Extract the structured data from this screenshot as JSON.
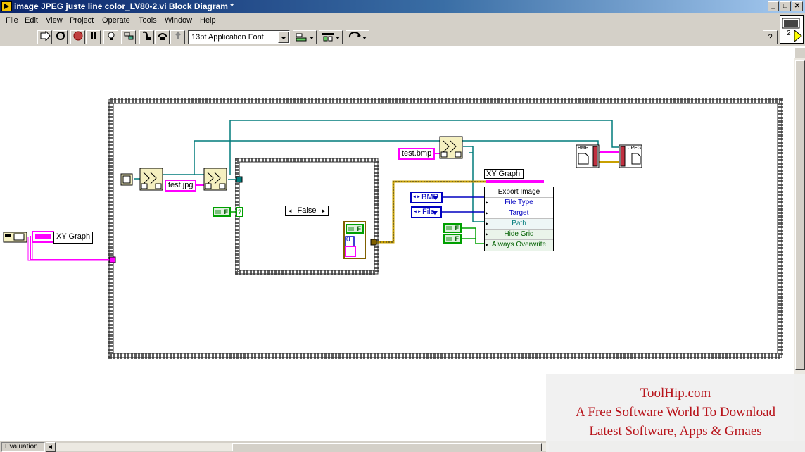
{
  "window": {
    "title": "image JPEG juste line color_LV80-2.vi Block Diagram *",
    "controls": {
      "minimize": "_",
      "maximize": "□",
      "close": "✕"
    },
    "doc_controls": {
      "minimize": "_",
      "maximize": "□",
      "close": "✕"
    }
  },
  "menu": [
    "File",
    "Edit",
    "View",
    "Project",
    "Operate",
    "Tools",
    "Window",
    "Help"
  ],
  "toolbar": {
    "font": "13pt Application Font",
    "buttons": [
      "run-arrow",
      "run-continuous",
      "abort",
      "pause",
      "highlight-execution",
      "retain-wire-values",
      "step-into",
      "step-over",
      "step-out"
    ],
    "help": "?"
  },
  "vi_icon": {
    "label": "2"
  },
  "diagram": {
    "xy_graph_terminal": "XY Graph",
    "string_jpg": "test.jpg",
    "string_bmp": "test.bmp",
    "case_selector": "False",
    "numeric_const": "0",
    "bool_true_label": "F",
    "property_node": {
      "title": "XY Graph",
      "rows": [
        "Export Image",
        "File Type",
        "Target",
        "Path",
        "Hide Grid",
        "Always Overwrite"
      ]
    },
    "enum_bmp": "BMP",
    "enum_file": "File",
    "bmp_block_label": "BMP",
    "jpeg_block_label": "JPEG"
  },
  "status": {
    "label": "Evaluation"
  },
  "watermark": {
    "line1": "ToolHip.com",
    "line2": "A Free Software World To Download",
    "line3": "Latest Software, Apps & Gmaes"
  },
  "colors": {
    "string_wire": "#ff00ff",
    "path_wire": "#007b7b",
    "boolean_wire": "#00a000",
    "enum_wire": "#0000c0",
    "structure_border": "#606060"
  }
}
